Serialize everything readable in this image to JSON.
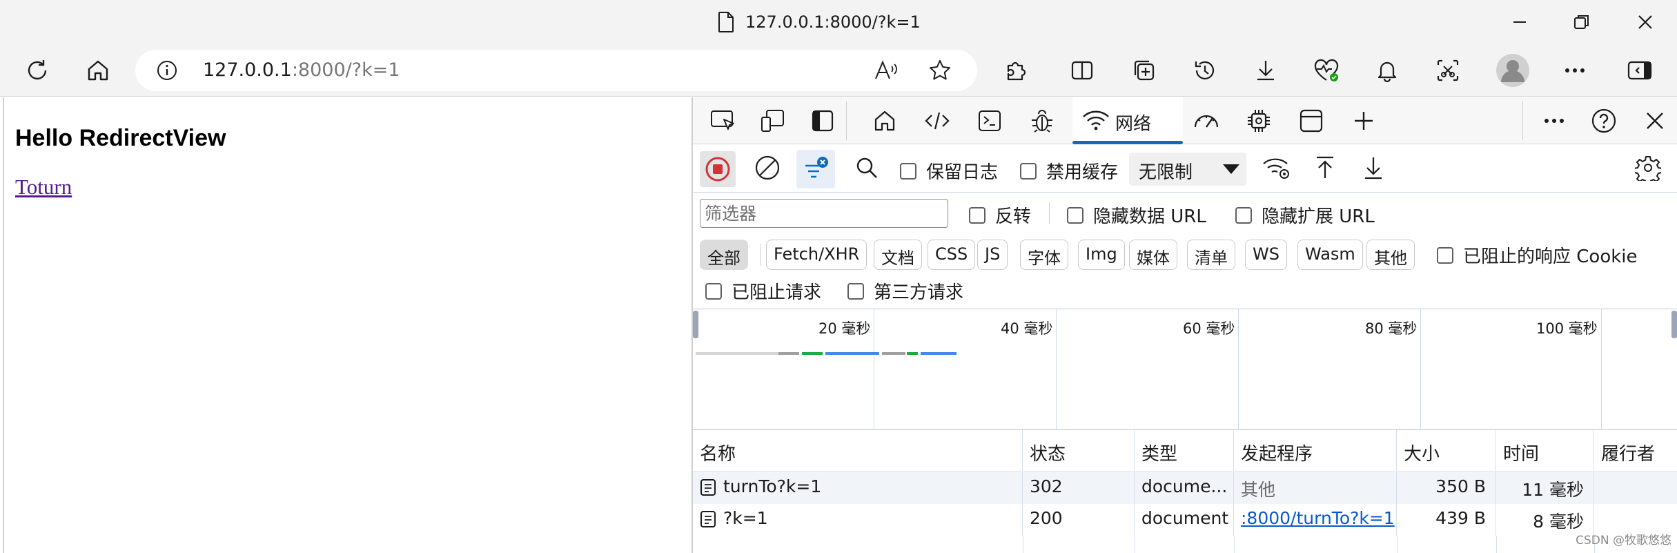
{
  "window": {
    "title": "127.0.0.1:8000/?k=1"
  },
  "toolbar": {
    "address_host": "127.0.0.1",
    "address_rest": ":8000/?k=1"
  },
  "page": {
    "heading": "Hello RedirectView",
    "link": "Toturn"
  },
  "devtools": {
    "network_tab_label": "网络",
    "preserve_log": "保留日志",
    "disable_cache": "禁用缓存",
    "throttling": "无限制",
    "filter_placeholder": "筛选器",
    "invert": "反转",
    "hide_data_urls": "隐藏数据 URL",
    "hide_extension_urls": "隐藏扩展 URL",
    "type_filters": [
      "全部",
      "Fetch/XHR",
      "文档",
      "CSS",
      "JS",
      "字体",
      "Img",
      "媒体",
      "清单",
      "WS",
      "Wasm",
      "其他"
    ],
    "blocked_response_cookies": "已阻止的响应 Cookie",
    "blocked_requests": "已阻止请求",
    "third_party_requests": "第三方请求",
    "overview_ticks": [
      "20 毫秒",
      "40 毫秒",
      "60 毫秒",
      "80 毫秒",
      "100 毫秒"
    ],
    "columns": [
      "名称",
      "状态",
      "类型",
      "发起程序",
      "大小",
      "时间",
      "履行者"
    ],
    "rows": [
      {
        "name": "turnTo?k=1",
        "status": "302",
        "type": "docume...",
        "initiator": "其他",
        "size": "350 B",
        "time": "11 毫秒"
      },
      {
        "name": "?k=1",
        "status": "200",
        "type": "document",
        "initiator": ":8000/turnTo?k=1",
        "size": "439 B",
        "time": "8 毫秒"
      }
    ]
  },
  "watermark": "CSDN @牧歌悠悠",
  "colors": {
    "accent": "#0f6cbd",
    "record_red": "#d13438",
    "chrome_bg": "#f3f3f3",
    "link_visited": "#551a8b"
  }
}
